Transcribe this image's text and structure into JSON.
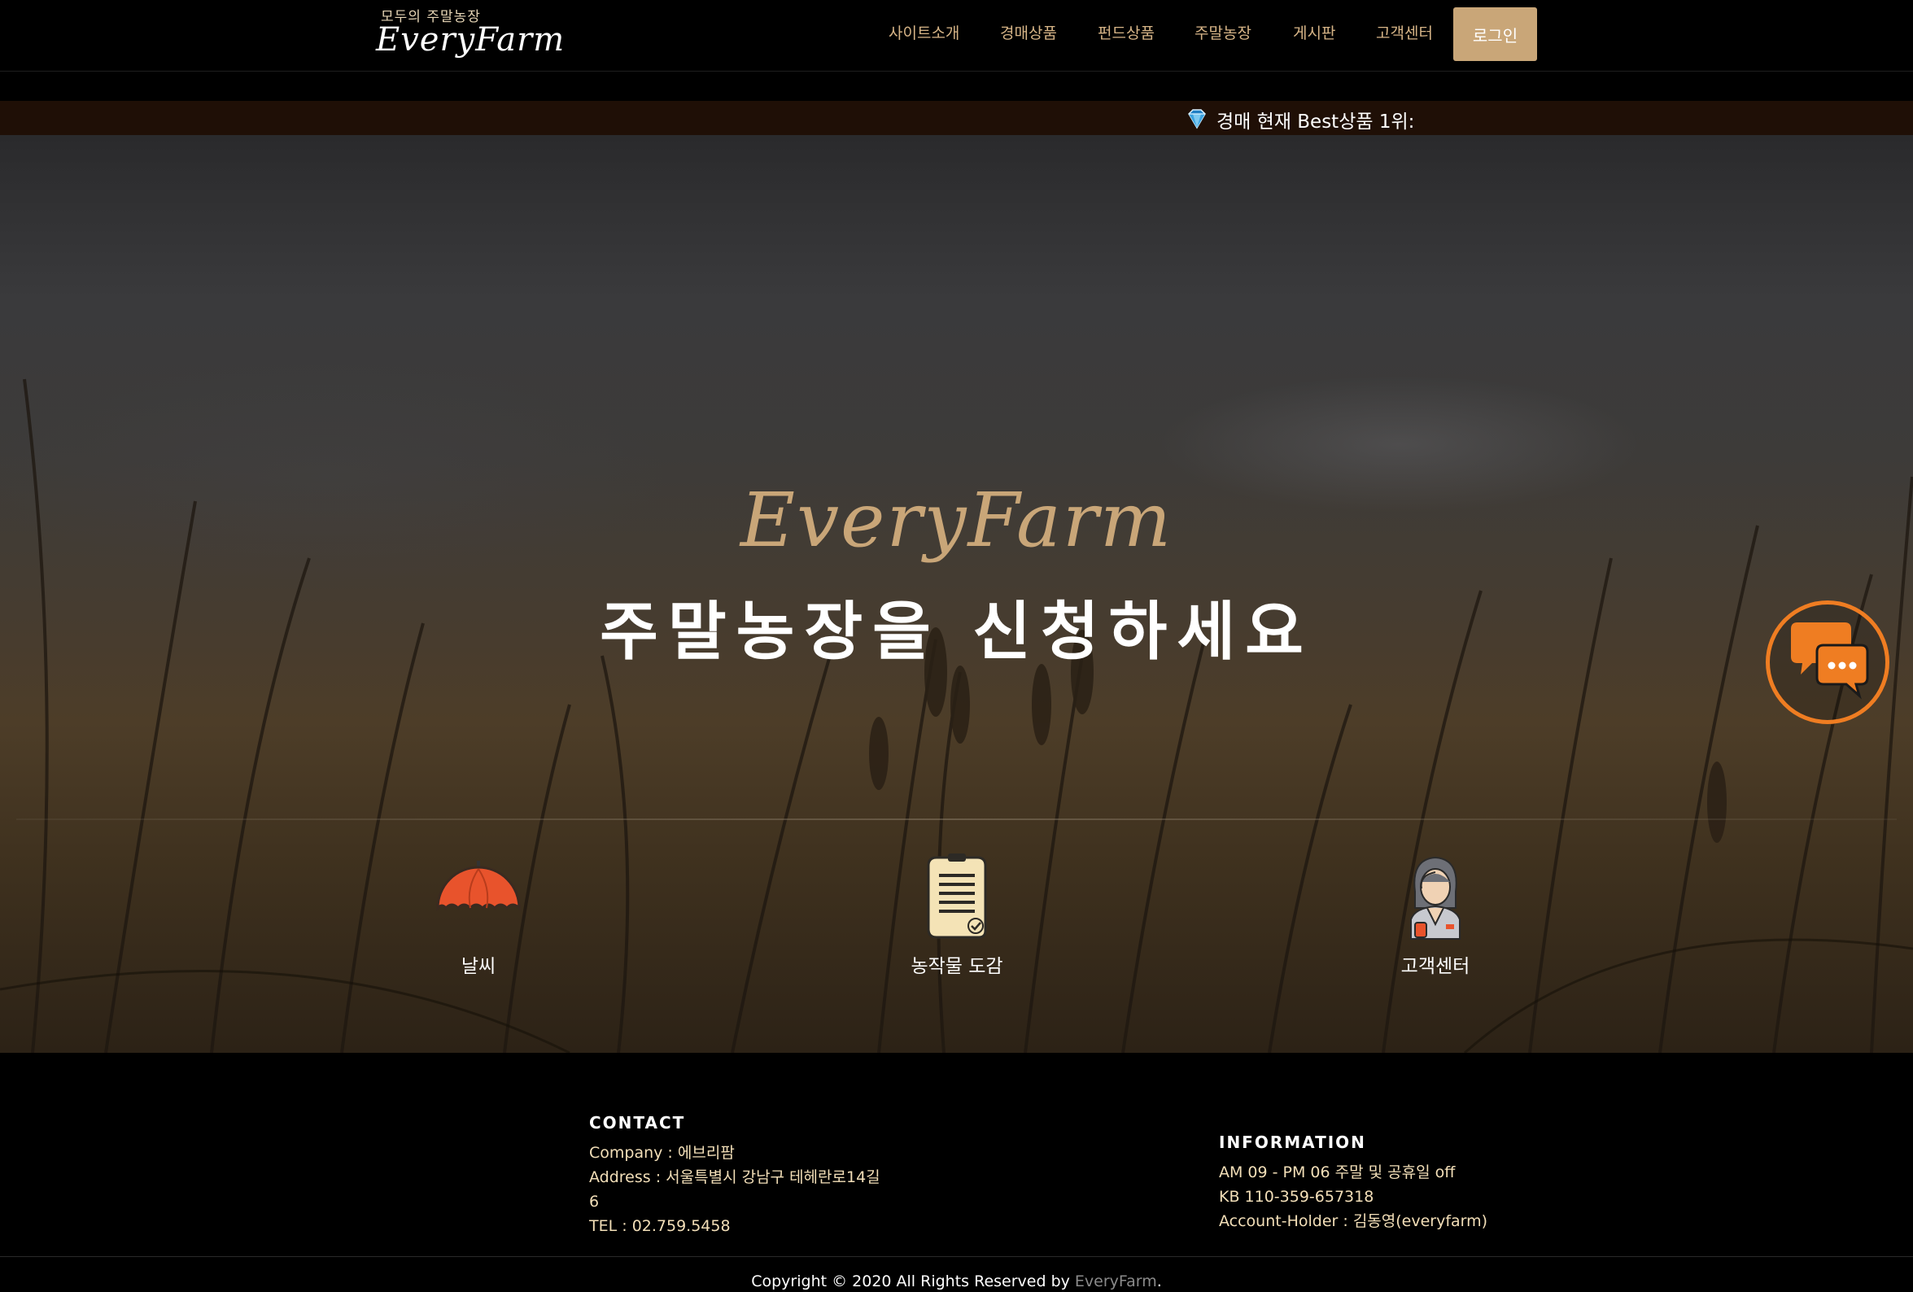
{
  "header": {
    "logo_small": "모두의 주말농장",
    "logo_big": "EveryFarm",
    "nav": [
      {
        "label": "사이트소개"
      },
      {
        "label": "경매상품"
      },
      {
        "label": "펀드상품"
      },
      {
        "label": "주말농장"
      },
      {
        "label": "게시판"
      },
      {
        "label": "고객센터"
      }
    ],
    "login_label": "로그인"
  },
  "ticker": {
    "icon": "diamond-icon",
    "text": "경매 현재 Best상품 1위:"
  },
  "hero": {
    "script_title": "EveryFarm",
    "main_title": "주말농장을 신청하세요",
    "features": [
      {
        "label": "날씨",
        "icon": "umbrella-icon"
      },
      {
        "label": "농작물 도감",
        "icon": "document-icon"
      },
      {
        "label": "고객센터",
        "icon": "customer-service-icon"
      }
    ]
  },
  "chat": {
    "icon": "chat-bubbles-icon",
    "color": "#ef7d22"
  },
  "footer": {
    "contact": {
      "heading": "CONTACT",
      "company_key": "Company :",
      "company_val": "에브리팜",
      "address_key": "Address :",
      "address_val": "서울특별시 강남구 테헤란로14길",
      "address_val2": "6",
      "tel_key": "TEL :",
      "tel_val": "02.759.5458"
    },
    "info": {
      "heading": "INFORMATION",
      "hours": "AM 09 - PM 06 주말 및 공휴일 off",
      "account": "KB 110-359-657318",
      "holder_key": "Account-Holder :",
      "holder_val": "김동영(everyfarm)"
    },
    "copyright_prefix": "Copyright © 2020 All Rights Reserved by",
    "copyright_brand": "EveryFarm",
    "copyright_suffix": "."
  },
  "colors": {
    "accent": "#c9a678",
    "ticker_bg": "#1f0f06",
    "footer_text": "#f3dfb8"
  }
}
